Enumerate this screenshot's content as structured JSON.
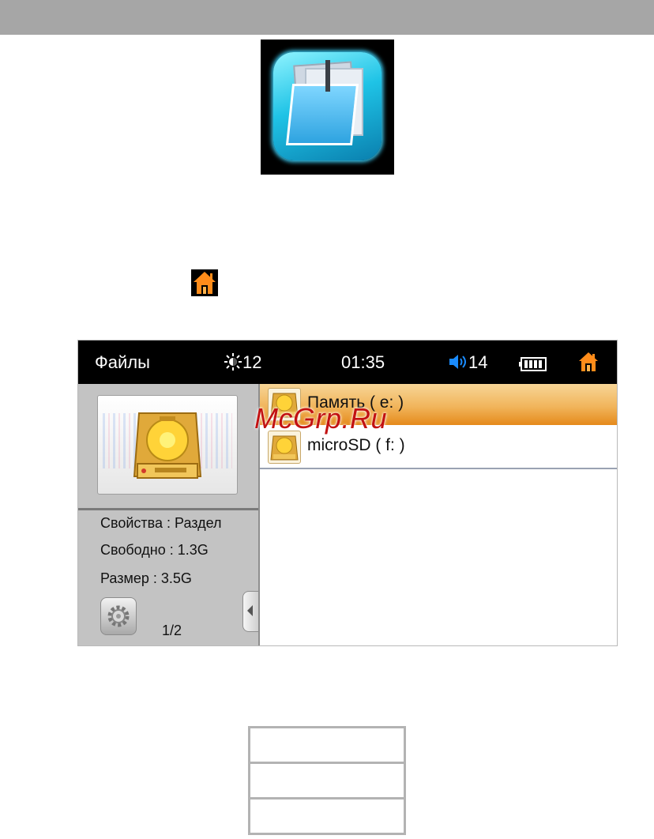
{
  "colors": {
    "top_bar": "#a6a6a6",
    "status_bar": "#000000",
    "selection_orange": "#f1b55c",
    "volume_blue": "#1a8cff",
    "home_orange": "#ff8c1a",
    "watermark_red": "#c21111"
  },
  "icons": {
    "app_icon": "files-folder-icon",
    "home_icon": "home-icon"
  },
  "device": {
    "status_bar": {
      "title": "Файлы",
      "brightness_icon": "sun-icon",
      "brightness_value": "12",
      "time": "01:35",
      "volume_icon": "speaker-icon",
      "volume_value": "14",
      "battery_icon": "battery-icon",
      "home_icon": "home-icon"
    },
    "left_panel": {
      "preview_icon": "hard-drive-icon",
      "properties_line": "Свойства : Раздел",
      "free_line": "Свободно : 1.3G",
      "size_line": "Размер : 3.5G",
      "settings_icon": "gear-icon",
      "page_indicator": "1/2",
      "collapse_icon": "chevron-left-icon"
    },
    "file_list": {
      "items": [
        {
          "label": "Память ( e: )",
          "icon": "drive-icon",
          "selected": true
        },
        {
          "label": "microSD ( f: )",
          "icon": "drive-icon",
          "selected": false
        }
      ]
    }
  },
  "watermark": "McGrp.Ru"
}
